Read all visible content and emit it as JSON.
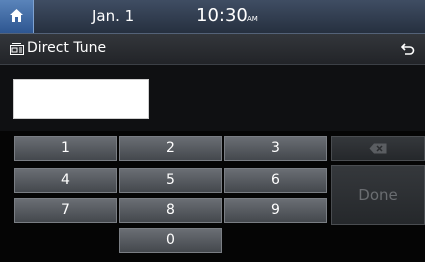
{
  "status_bar": {
    "home_icon": "home-icon",
    "date": "Jan.  1",
    "time": "10:30",
    "ampm": "AM"
  },
  "title_bar": {
    "icon": "radio-tune-icon",
    "title": "Direct Tune",
    "back_icon": "back-arrow-icon"
  },
  "frequency_input": {
    "value": ""
  },
  "keypad": {
    "keys": [
      "1",
      "2",
      "3",
      "4",
      "5",
      "6",
      "7",
      "8",
      "9",
      "0"
    ],
    "delete_icon": "backspace-icon",
    "done_label": "Done",
    "done_enabled": false
  },
  "colors": {
    "statusbar": "#2f3a4c",
    "home_button": "#3f6aa6",
    "key": "#55595e",
    "disabled_text": "#6a6d71"
  }
}
